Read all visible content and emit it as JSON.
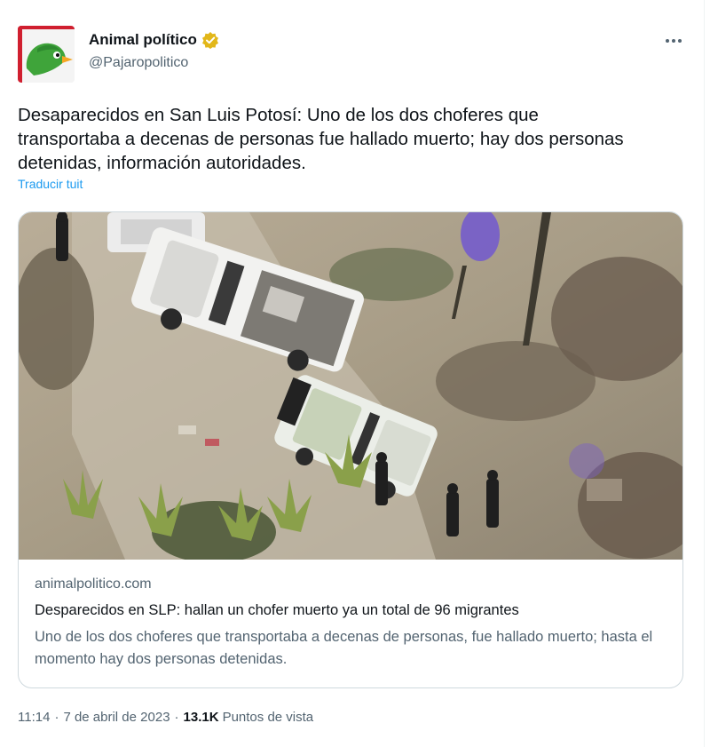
{
  "account": {
    "display_name": "Animal político",
    "handle": "@Pajaropolitico"
  },
  "tweet": {
    "text": "Desaparecidos en San Luis Potosí: Uno de los dos choferes que transportaba a decenas de personas fue hallado muerto; hay dos personas detenidas, información autoridades.",
    "translate_label": "Traducir tuit"
  },
  "card": {
    "domain": "animalpolitico.com",
    "title": "Desparecidos en SLP: hallan un chofer muerto ya un total de 96 migrantes",
    "description": "Uno de los dos choferes que transportaba a decenas de personas, fue hallado muerto; hasta el momento hay dos personas detenidas."
  },
  "meta": {
    "time": "11:14",
    "separator": "·",
    "date": "7 de abril de 2023",
    "views_count": "13.1K",
    "views_label": "Puntos de vista"
  },
  "colors": {
    "text": "#0f1419",
    "secondary": "#536471",
    "link": "#1d9bf0",
    "verified": "#e2b719",
    "border": "#cfd9de"
  },
  "icons": {
    "verified": "verified-badge-icon",
    "more": "more-options-icon"
  }
}
